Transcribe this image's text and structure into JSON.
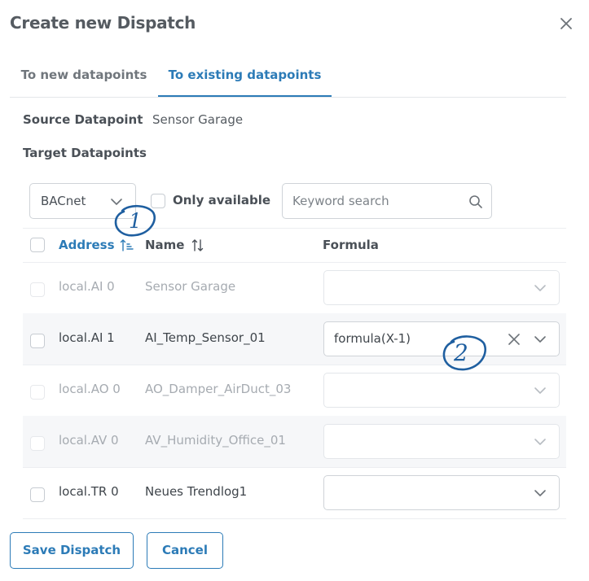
{
  "dialog": {
    "title": "Create new Dispatch"
  },
  "tabs": [
    {
      "label": "To new datapoints",
      "active": false
    },
    {
      "label": "To existing datapoints",
      "active": true
    }
  ],
  "source": {
    "label": "Source Datapoint",
    "value": "Sensor Garage"
  },
  "target": {
    "label": "Target Datapoints"
  },
  "filters": {
    "protocol": "BACnet",
    "only_available_label": "Only available",
    "search_placeholder": "Keyword search"
  },
  "table": {
    "headers": {
      "address": "Address",
      "name": "Name",
      "formula": "Formula"
    },
    "rows": [
      {
        "address": "local.AI 0",
        "name": "Sensor Garage",
        "formula": "",
        "enabled": false
      },
      {
        "address": "local.AI 1",
        "name": "AI_Temp_Sensor_01",
        "formula": "formula(X-1)",
        "enabled": true
      },
      {
        "address": "local.AO 0",
        "name": "AO_Damper_AirDuct_03",
        "formula": "",
        "enabled": false
      },
      {
        "address": "local.AV 0",
        "name": "AV_Humidity_Office_01",
        "formula": "",
        "enabled": false
      },
      {
        "address": "local.TR 0",
        "name": "Neues Trendlog1",
        "formula": "",
        "enabled": true
      }
    ]
  },
  "annotations": [
    "1",
    "2"
  ],
  "buttons": {
    "save": "Save Dispatch",
    "cancel": "Cancel"
  },
  "colors": {
    "accent": "#2c7bb7",
    "annotation": "#1f5fa0",
    "disabled_text": "#a6abb1"
  },
  "icons": [
    "close-icon",
    "chevron-down-icon",
    "sort-ascending-icon",
    "sort-icon",
    "search-icon",
    "clear-icon"
  ]
}
